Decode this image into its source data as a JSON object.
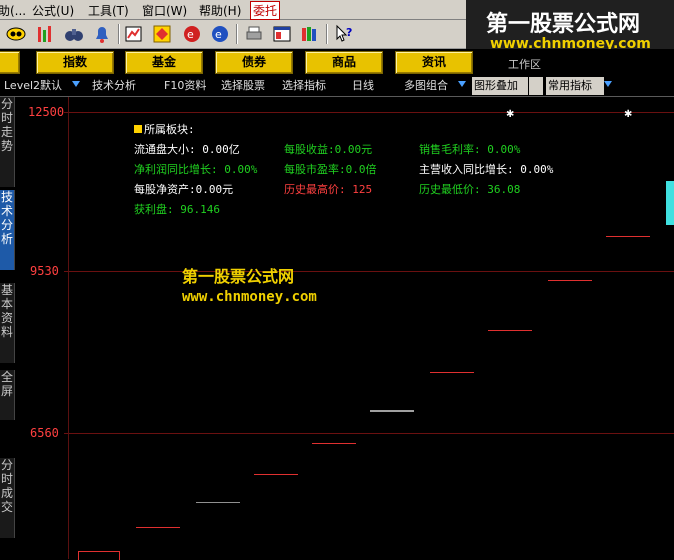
{
  "menubar": {
    "items": [
      "帮助(...",
      "公式(U)",
      "工具(T)",
      "窗口(W)",
      "帮助(H)"
    ],
    "active": "委托"
  },
  "watermark": {
    "site_name": "第一股票公式网",
    "url": "www.chnmoney.com"
  },
  "toolbar": {
    "help_icon_label": "?"
  },
  "function_buttons": [
    "指数",
    "基金",
    "债券",
    "商品",
    "资讯"
  ],
  "tabs": {
    "level2": "Level2默认",
    "tech_analysis": "技术分析",
    "f10": "F10资料",
    "select_stock": "选择股票",
    "select_indicator": "选择指标",
    "daily": "日线",
    "multi_chart": "多图组合",
    "overlay": "图形叠加",
    "common_indicator": "常用指标",
    "workspace": "工作区"
  },
  "vertical_tabs": [
    "分时走势",
    "技术分析",
    "基本资料",
    "全屏",
    "分时成交"
  ],
  "price_axis": {
    "p1": "12500",
    "p2": "9530",
    "p3": "6560"
  },
  "info_panel": {
    "sector": "所属板块:",
    "float_size": "流通盘大小: 0.00亿",
    "eps": "每股收益:0.00元",
    "gross_margin": "销售毛利率: 0.00%",
    "net_profit_yoy": "净利润同比增长: 0.00%",
    "pe": "每股市盈率:0.0倍",
    "revenue_yoy": "主营收入同比增长: 0.00%",
    "nav": "每股净资产:0.00元",
    "hist_high": "历史最高价: 125",
    "hist_low": "历史最低价: 36.08",
    "profit_ratio": "获利盘: 96.146"
  },
  "chart_watermark": {
    "site_name": "第一股票公式网",
    "url": "www.chnmoney.com"
  },
  "colors": {
    "background": "#000000",
    "up_candle": "#e03030",
    "function_button": "#e8c200",
    "info_white": "#ffffff",
    "info_green": "#20d020",
    "info_red": "#ff4040"
  }
}
